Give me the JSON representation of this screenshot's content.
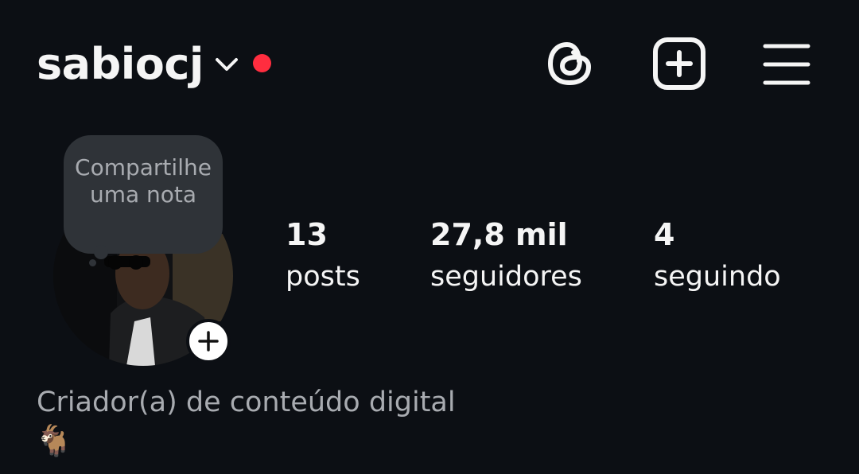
{
  "header": {
    "username": "sabiocj",
    "icons": {
      "switch_account": "chevron-down-icon",
      "status": "notification-dot",
      "threads": "threads-icon",
      "create": "add-square-icon",
      "menu": "hamburger-menu-icon"
    },
    "dot_color": "#ff2d3f"
  },
  "profile": {
    "note_prompt": "Compartilhe uma nota",
    "add_story_icon": "plus-icon"
  },
  "stats": {
    "posts": {
      "value": "13",
      "label": "posts"
    },
    "followers": {
      "value": "27,8 mil",
      "label": "seguidores"
    },
    "following": {
      "value": "4",
      "label": "seguindo"
    }
  },
  "bio": {
    "category": "Criador(a) de conteúdo digital",
    "text": "🐐"
  },
  "colors": {
    "background": "#0c0f14",
    "text": "#f5f5f5",
    "muted_text": "#a8abb0",
    "note_bubble": "#2f3338"
  }
}
